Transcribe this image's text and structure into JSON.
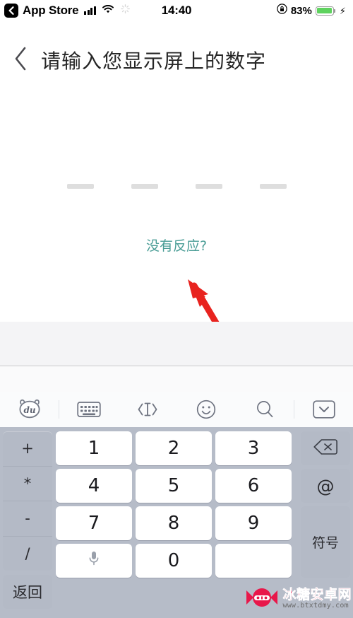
{
  "status_bar": {
    "back_app": "App Store",
    "back_icon": "back-chevron-icon",
    "signal_icon": "cellular-signal-icon",
    "wifi_icon": "wifi-icon",
    "spinner_icon": "activity-spinner-icon",
    "time": "14:40",
    "rotation_lock_icon": "rotation-lock-icon",
    "battery_percent": "83%",
    "battery_icon": "battery-icon",
    "charging_icon": "lightning-bolt-icon"
  },
  "navbar": {
    "back_icon": "chevron-left-icon",
    "title": "请输入您显示屏上的数字"
  },
  "content": {
    "code_slots": [
      "",
      "",
      "",
      ""
    ],
    "slot_count": 4,
    "no_response_link": "没有反应?",
    "link_color": "#4a9d96",
    "annotation_arrow": {
      "icon": "red-arrow-annotation",
      "color": "#e8231f"
    }
  },
  "ime_toolbar": {
    "tools": [
      {
        "name": "baidu-bear-logo-icon",
        "label": "du"
      },
      {
        "name": "keyboard-switch-icon",
        "label": ""
      },
      {
        "name": "cursor-move-icon",
        "label": ""
      },
      {
        "name": "emoji-icon",
        "label": ""
      },
      {
        "name": "search-icon",
        "label": ""
      },
      {
        "name": "collapse-keyboard-icon",
        "label": ""
      }
    ]
  },
  "keyboard": {
    "background_color": "#b6bcc8",
    "operators": [
      "+",
      "*",
      "-",
      "/"
    ],
    "return_label": "返回",
    "digits": [
      "1",
      "2",
      "3",
      "4",
      "5",
      "6",
      "7",
      "8",
      "9"
    ],
    "bottom_row": [
      {
        "name": "voice-input-key",
        "label": ""
      },
      {
        "name": "digit-key-0",
        "label": "0"
      },
      {
        "name": "enter-key",
        "label": ""
      }
    ],
    "right_keys": [
      {
        "name": "backspace-key",
        "label": "",
        "icon": "backspace-icon"
      },
      {
        "name": "at-sign-key",
        "label": "@",
        "icon": "at-icon"
      },
      {
        "name": "symbols-key",
        "label": "符号",
        "icon": ""
      }
    ]
  },
  "watermark": {
    "site_name": "冰糖安卓网",
    "site_url": "www.btxtdmy.com",
    "logo_icon": "candy-logo-icon",
    "color": "#e8174a"
  }
}
